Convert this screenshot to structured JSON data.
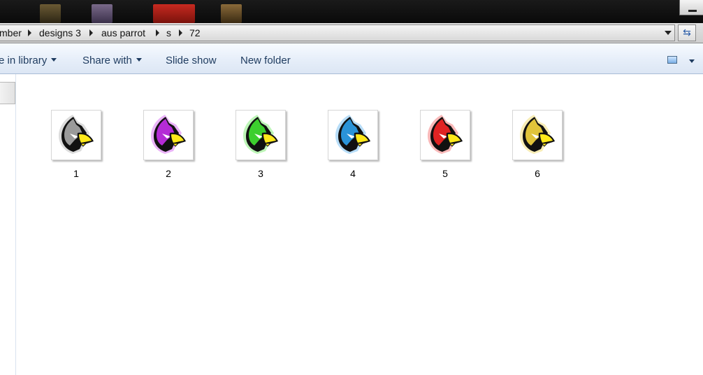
{
  "breadcrumb": [
    {
      "label": "mber"
    },
    {
      "label": "designs 3"
    },
    {
      "label": "aus parrot"
    },
    {
      "label": "s"
    },
    {
      "label": "72"
    }
  ],
  "toolbar": {
    "include_label": "e in library",
    "share_label": "Share with",
    "slideshow_label": "Slide show",
    "newfolder_label": "New folder"
  },
  "files": [
    {
      "name": "1",
      "color": "#9a9a9a",
      "glow": "#d0d0d0"
    },
    {
      "name": "2",
      "color": "#b42bd6",
      "glow": "#e39af5"
    },
    {
      "name": "3",
      "color": "#3ccf2e",
      "glow": "#a6f29d"
    },
    {
      "name": "4",
      "color": "#2a93d8",
      "glow": "#9fd2f5"
    },
    {
      "name": "5",
      "color": "#e02323",
      "glow": "#f7a2a2"
    },
    {
      "name": "6",
      "color": "#e1c43a",
      "glow": "#f6e79e"
    }
  ],
  "icons": {
    "file_thumbnail": "parrot-head-icon",
    "view": "view-options-icon",
    "refresh": "refresh-icon"
  }
}
